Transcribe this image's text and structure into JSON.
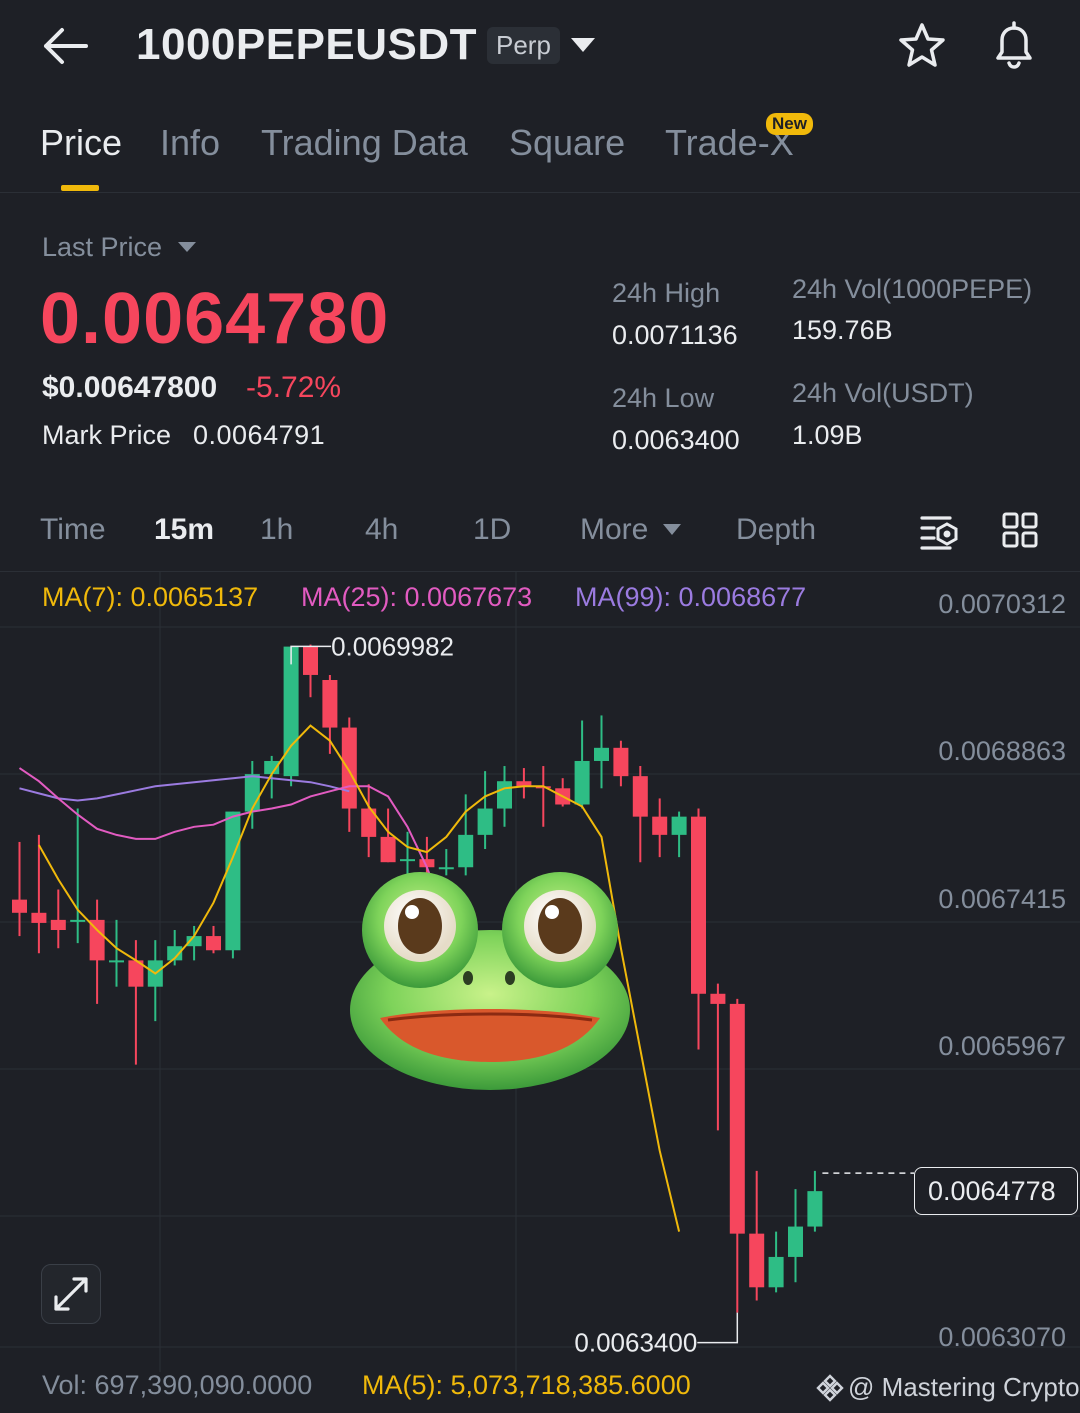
{
  "header": {
    "back_icon": "arrow-left-icon",
    "symbol": "1000PEPEUSDT",
    "contract_type": "Perp",
    "star_icon": "star-icon",
    "bell_icon": "bell-icon"
  },
  "tabs": [
    {
      "label": "Price",
      "active": true
    },
    {
      "label": "Info"
    },
    {
      "label": "Trading Data"
    },
    {
      "label": "Square"
    },
    {
      "label": "Trade-X",
      "badge": "New"
    }
  ],
  "price_panel": {
    "last_price_label": "Last Price",
    "last_price": "0.0064780",
    "usd_price": "$0.00647800",
    "change_pct": "-5.72%",
    "mark_price_label": "Mark Price",
    "mark_price": "0.0064791",
    "high_label": "24h High",
    "high": "0.0071136",
    "low_label": "24h Low",
    "low": "0.0063400",
    "vol_base_label": "24h Vol(1000PEPE)",
    "vol_base": "159.76B",
    "vol_quote_label": "24h Vol(USDT)",
    "vol_quote": "1.09B"
  },
  "intervals": {
    "time": "Time",
    "m15": "15m",
    "h1": "1h",
    "h4": "4h",
    "d1": "1D",
    "more": "More",
    "depth": "Depth",
    "active": "15m"
  },
  "ma_legend": {
    "ma7": "MA(7): 0.0065137",
    "ma25": "MA(25): 0.0067673",
    "ma99": "MA(99): 0.0068677"
  },
  "chart_data": {
    "type": "candlestick",
    "y_axis_ticks": [
      "0.0070312",
      "0.0068863",
      "0.0067415",
      "0.0065967",
      "0.0063070"
    ],
    "current_price_tag": "0.0064778",
    "high_marker": "0.0069982",
    "low_marker": "0.0063400",
    "ylim": [
      0.0063,
      0.00705
    ],
    "candles": [
      {
        "o": 0.006748,
        "h": 0.006805,
        "l": 0.006712,
        "c": 0.006735
      },
      {
        "o": 0.006735,
        "h": 0.006812,
        "l": 0.006695,
        "c": 0.006725
      },
      {
        "o": 0.006728,
        "h": 0.006758,
        "l": 0.0067,
        "c": 0.006718
      },
      {
        "o": 0.006728,
        "h": 0.006838,
        "l": 0.006705,
        "c": 0.006728
      },
      {
        "o": 0.006728,
        "h": 0.006748,
        "l": 0.006645,
        "c": 0.006688
      },
      {
        "o": 0.006688,
        "h": 0.006728,
        "l": 0.006662,
        "c": 0.006688
      },
      {
        "o": 0.006688,
        "h": 0.006708,
        "l": 0.006585,
        "c": 0.006662
      },
      {
        "o": 0.006662,
        "h": 0.006708,
        "l": 0.006628,
        "c": 0.006688
      },
      {
        "o": 0.006688,
        "h": 0.006718,
        "l": 0.006683,
        "c": 0.006702
      },
      {
        "o": 0.006702,
        "h": 0.006722,
        "l": 0.006688,
        "c": 0.006712
      },
      {
        "o": 0.006712,
        "h": 0.006722,
        "l": 0.006695,
        "c": 0.006698
      },
      {
        "o": 0.006698,
        "h": 0.006835,
        "l": 0.00669,
        "c": 0.006835
      },
      {
        "o": 0.006835,
        "h": 0.006885,
        "l": 0.006818,
        "c": 0.006872
      },
      {
        "o": 0.006872,
        "h": 0.00689,
        "l": 0.006848,
        "c": 0.006885
      },
      {
        "o": 0.00687,
        "h": 0.006975,
        "l": 0.00686,
        "c": 0.006998
      },
      {
        "o": 0.006998,
        "h": 0.007,
        "l": 0.006948,
        "c": 0.00697
      },
      {
        "o": 0.006965,
        "h": 0.00697,
        "l": 0.006892,
        "c": 0.006918
      },
      {
        "o": 0.006918,
        "h": 0.006928,
        "l": 0.006815,
        "c": 0.006838
      },
      {
        "o": 0.006838,
        "h": 0.006862,
        "l": 0.00679,
        "c": 0.00681
      },
      {
        "o": 0.00681,
        "h": 0.006838,
        "l": 0.006785,
        "c": 0.006785
      },
      {
        "o": 0.006788,
        "h": 0.006815,
        "l": 0.006772,
        "c": 0.006788
      },
      {
        "o": 0.006788,
        "h": 0.00681,
        "l": 0.006768,
        "c": 0.00678
      },
      {
        "o": 0.00678,
        "h": 0.006798,
        "l": 0.006772,
        "c": 0.00678
      },
      {
        "o": 0.00678,
        "h": 0.006852,
        "l": 0.006772,
        "c": 0.006812
      },
      {
        "o": 0.006812,
        "h": 0.006875,
        "l": 0.006798,
        "c": 0.006838
      },
      {
        "o": 0.006838,
        "h": 0.00688,
        "l": 0.00682,
        "c": 0.006865
      },
      {
        "o": 0.006865,
        "h": 0.006878,
        "l": 0.006848,
        "c": 0.00686
      },
      {
        "o": 0.00686,
        "h": 0.00688,
        "l": 0.00682,
        "c": 0.006858
      },
      {
        "o": 0.006858,
        "h": 0.006868,
        "l": 0.00684,
        "c": 0.006842
      },
      {
        "o": 0.006842,
        "h": 0.006925,
        "l": 0.006838,
        "c": 0.006885
      },
      {
        "o": 0.006885,
        "h": 0.00693,
        "l": 0.006858,
        "c": 0.006898
      },
      {
        "o": 0.006898,
        "h": 0.006905,
        "l": 0.00686,
        "c": 0.00687
      },
      {
        "o": 0.00687,
        "h": 0.00688,
        "l": 0.006785,
        "c": 0.00683
      },
      {
        "o": 0.00683,
        "h": 0.006848,
        "l": 0.00679,
        "c": 0.006812
      },
      {
        "o": 0.006812,
        "h": 0.006835,
        "l": 0.00679,
        "c": 0.00683
      },
      {
        "o": 0.00683,
        "h": 0.006838,
        "l": 0.0066,
        "c": 0.006655
      },
      {
        "o": 0.006655,
        "h": 0.006665,
        "l": 0.00652,
        "c": 0.006645
      },
      {
        "o": 0.006645,
        "h": 0.00665,
        "l": 0.00634,
        "c": 0.006418
      },
      {
        "o": 0.006418,
        "h": 0.00648,
        "l": 0.006352,
        "c": 0.006365
      },
      {
        "o": 0.006365,
        "h": 0.00642,
        "l": 0.00636,
        "c": 0.006395
      },
      {
        "o": 0.006395,
        "h": 0.006462,
        "l": 0.00637,
        "c": 0.006425
      },
      {
        "o": 0.006425,
        "h": 0.00648,
        "l": 0.00642,
        "c": 0.00646
      }
    ],
    "ma7_series": [
      0.006802,
      0.006768,
      0.006738,
      0.006718,
      0.0067,
      0.006688,
      0.006675,
      0.00669,
      0.006712,
      0.006745,
      0.00679,
      0.006838,
      0.006872,
      0.0069,
      0.00692,
      0.006905,
      0.006875,
      0.00684,
      0.006815,
      0.0068,
      0.006795,
      0.00681,
      0.006835,
      0.00685,
      0.006858,
      0.00686,
      0.00686,
      0.00685,
      0.00684,
      0.00681,
      0.0067,
      0.0066,
      0.0065,
      0.00642
    ],
    "ma25_series": [
      0.006878,
      0.006865,
      0.006848,
      0.006832,
      0.006818,
      0.006812,
      0.006808,
      0.006808,
      0.006815,
      0.00682,
      0.006822,
      0.00683,
      0.006835,
      0.006838,
      0.006842,
      0.00685,
      0.006855,
      0.00686,
      0.00686,
      0.00685,
      0.00682,
      0.00678,
      0.00673,
      0.00668
    ],
    "ma99_series": [
      0.006858,
      0.006853,
      0.006848,
      0.006846,
      0.006848,
      0.006852,
      0.006856,
      0.00686,
      0.006862,
      0.006864,
      0.006866,
      0.006868,
      0.00687,
      0.006868,
      0.006866,
      0.006864,
      0.00686,
      0.006855
    ]
  },
  "footer": {
    "vol": "Vol: 697,390,090.0000",
    "ma5": "MA(5): 5,073,718,385.6000",
    "watermark": "@ Mastering Crypto"
  },
  "colors": {
    "bg": "#1e2026",
    "up": "#2ebd85",
    "down": "#f6465d",
    "ma7": "#f0b90b",
    "ma25": "#e25bc1",
    "ma99": "#9b7be0"
  }
}
